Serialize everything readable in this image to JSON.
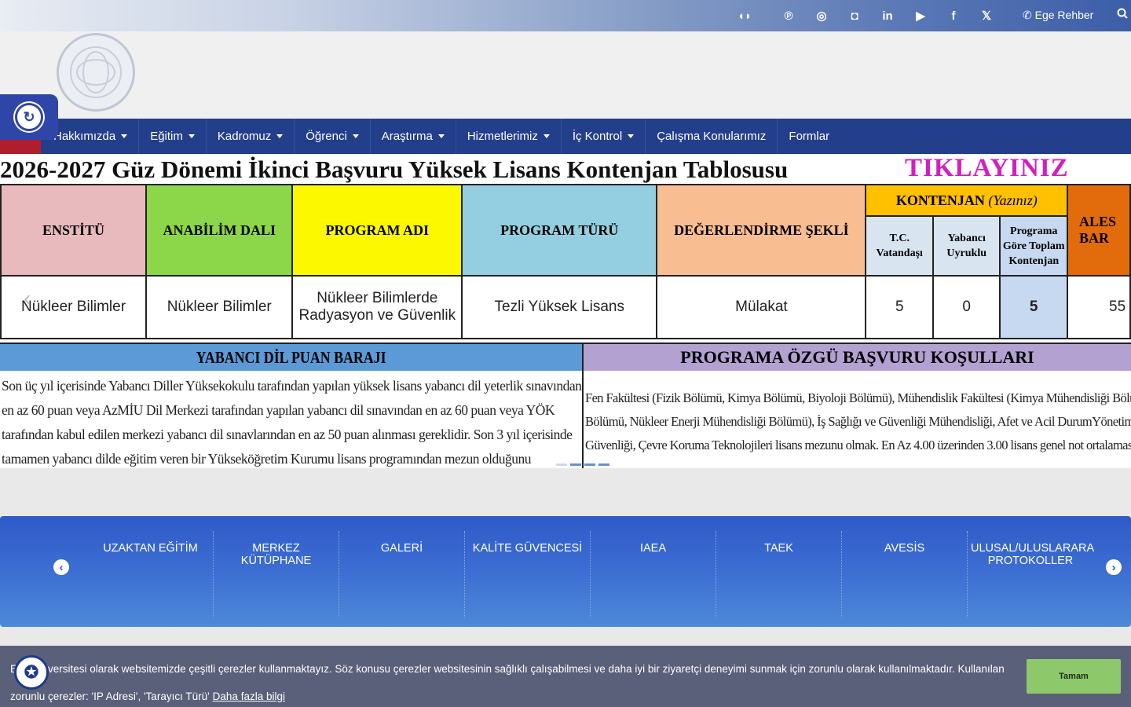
{
  "topbar": {
    "icons": [
      "brand-icon",
      "pinterest-icon",
      "instagram-icon",
      "flickr-icon",
      "linkedin-icon",
      "youtube-icon",
      "facebook-icon",
      "x-icon"
    ],
    "rehber_label": "Ege Rehber"
  },
  "nav": {
    "items": [
      {
        "label": "Hakkımızda"
      },
      {
        "label": "Eğitim"
      },
      {
        "label": "Kadromuz"
      },
      {
        "label": "Öğrenci"
      },
      {
        "label": "Araştırma"
      },
      {
        "label": "Hizmetlerimiz"
      },
      {
        "label": "İç Kontrol"
      },
      {
        "label": "Çalışma Konularımız"
      },
      {
        "label": "Formlar"
      }
    ]
  },
  "slide": {
    "title": "2026-2027 Güz Dönemi İkinci Başvuru Yüksek Lisans Kontenjan Tablosusu",
    "cta": "TIKLAYINIZ",
    "headers": {
      "enstitu": "ENSTİTÜ",
      "anabilim": "ANABİLİM DALI",
      "program": "PROGRAM ADI",
      "tur": "PROGRAM TÜRÜ",
      "deger": "DEĞERLENDİRME ŞEKLİ",
      "kontenjan": "KONTENJAN",
      "kontenjan_note": "(Yazınız)",
      "tc": "T.C. Vatandaşı",
      "yabanci": "Yabancı Uyruklu",
      "toplam": "Programa Göre Toplam Kontenjan",
      "ales": "ALES BAR"
    },
    "row": {
      "enstitu": "Nükleer Bilimler",
      "anabilim": "Nükleer Bilimler",
      "program": "Nükleer Bilimlerde Radyasyon ve Güvenlik",
      "tur": "Tezli Yüksek Lisans",
      "deger": "Mülakat",
      "tc": "5",
      "yabanci": "0",
      "toplam": "5",
      "ales": "55"
    },
    "yabanci_dil_title": "YABANCI DİL PUAN BARAJI",
    "yabanci_dil_text": "Son üç yıl içerisinde Yabancı Diller Yüksekokulu tarafından yapılan yüksek lisans yabancı dil yeterlik sınavından en az 60 puan veya AzMİU Dil Merkezi tarafından yapılan yabancı dil sınavından en az 60 puan veya YÖK tarafından kabul edilen merkezi yabancı dil sınavlarından en az 50 puan alınması gereklidir. Son 3 yıl içerisinde tamamen yabancı dilde eğitim veren bir Yükseköğretim Kurumu lisans programından mezun olduğunu belirleyen adaylardan yabancı dil belgesi aranmaz.",
    "kosullar_title": "PROGRAMA ÖZGÜ BAŞVURU KOŞULLARI",
    "kosullar_lines": [
      "Fen Fakültesi (Fizik Bölümü, Kimya Bölümü, Biyoloji Bölümü), Mühendislik Fakültesi (Kimya Mühendisliği Bölümü, Çevre Mühendis",
      "Bölümü, Nükleer Enerji Mühendisliği Bölümü), İş Sağlığı  ve Güvenliği Mühendisliği, Afet ve Acil DurumYönetimi, Çevre ve İnsan Ra",
      "Güvenliği, Çevre Koruma Teknolojileri lisans mezunu olmak. En Az 4.00 üzerinden 3.00 lisans genel not ortalamasına sahip olmak."
    ]
  },
  "quick_links": [
    "UZAKTAN EĞİTİM",
    "MERKEZ KÜTÜPHANE",
    "GALERİ",
    "KALİTE GÜVENCESİ",
    "IAEA",
    "TAEK",
    "AVESİS",
    "ULUSAL/ULUSLARARA PROTOKOLLER"
  ],
  "cookie": {
    "text": "Ege Üniversitesi olarak websitemizde çeşitli çerezler kullanmaktayız. Söz konusu çerezler websitesinin sağlıklı çalışabilmesi ve daha iyi bir ziyaretçi deneyimi sunmak için zorunlu olarak kullanılmaktadır. Kullanılan zorunlu çerezler: 'IP Adresi', 'Tarayıcı Türü'",
    "link": "Daha fazla bilgi",
    "button": "Tamam"
  },
  "colors": {
    "nav_bg": "#233f8c",
    "cta_magenta": "#d21fbf",
    "cookie_button": "#8dc96a"
  }
}
